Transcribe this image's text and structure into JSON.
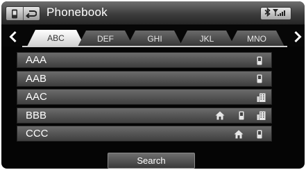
{
  "header": {
    "title": "Phonebook",
    "icons": [
      "phone-icon",
      "back-icon"
    ],
    "status_icons": [
      "bluetooth-icon",
      "signal-strength-icon"
    ]
  },
  "tabs": [
    {
      "label": "ABC",
      "active": true
    },
    {
      "label": "DEF",
      "active": false
    },
    {
      "label": "GHI",
      "active": false
    },
    {
      "label": "JKL",
      "active": false
    },
    {
      "label": "MNO",
      "active": false
    }
  ],
  "contacts": [
    {
      "name": "AAA",
      "icons": [
        "mobile-icon"
      ]
    },
    {
      "name": "AAB",
      "icons": [
        "mobile-icon"
      ]
    },
    {
      "name": "AAC",
      "icons": [
        "work-icon"
      ]
    },
    {
      "name": "BBB",
      "icons": [
        "home-icon",
        "mobile-icon",
        "work-icon"
      ]
    },
    {
      "name": "CCC",
      "icons": [
        "home-icon",
        "mobile-icon"
      ]
    }
  ],
  "search_label": "Search",
  "colors": {
    "background": "#050505",
    "row": "#555555",
    "text": "#ffffff",
    "active_tab": "#e6e6e6"
  }
}
